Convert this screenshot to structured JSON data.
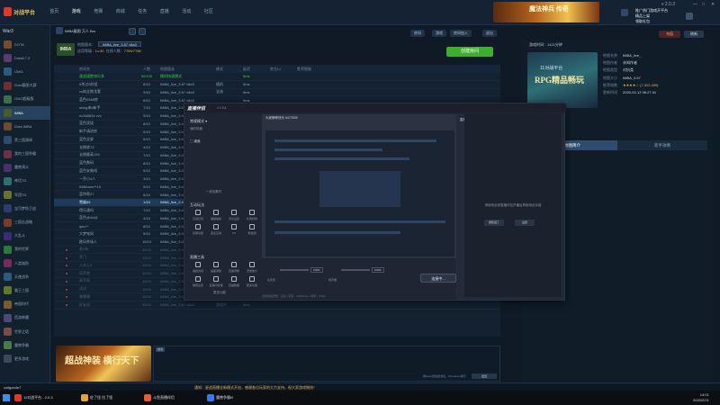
{
  "app": {
    "logo": "对战平台",
    "version": "v 2.0.3"
  },
  "topnav": [
    "首页",
    "游戏",
    "竞赛",
    "商城",
    "任务",
    "直播",
    "活动",
    "社区"
  ],
  "topnav_active": 1,
  "top_banner": {
    "text": "魔法神兵 传奇"
  },
  "top_ad": {
    "line1": "推广热门游戏开平台",
    "line2": "精品上架",
    "line3": "领取礼包"
  },
  "coin_btn": "充值",
  "refresh_btn": "刷新",
  "sidebar": {
    "title": "War3",
    "items": [
      {
        "label": "DOTA",
        "color": "#7a4b2a"
      },
      {
        "label": "Dota6.7.0",
        "color": "#5b3b6e"
      },
      {
        "label": "OMG",
        "color": "#2f5b7a"
      },
      {
        "label": "Dota截图大赛",
        "color": "#6e2f2f"
      },
      {
        "label": "OMG超级版",
        "color": "#3b6e4a"
      },
      {
        "label": "IMBA",
        "color": "#4a5a2f",
        "active": true
      },
      {
        "label": "Dota IMBA",
        "color": "#6e4a2f"
      },
      {
        "label": "黑三国演绎",
        "color": "#2f4a6e"
      },
      {
        "label": "我的三国争霸",
        "color": "#6e2f4a"
      },
      {
        "label": "魔兽演义",
        "color": "#4a2f6e"
      },
      {
        "label": "神话TD",
        "color": "#2f6e6e"
      },
      {
        "label": "军团TD",
        "color": "#6e6e2f"
      },
      {
        "label": "宝可梦防卫战",
        "color": "#2f3b6e"
      },
      {
        "label": "三国志战略",
        "color": "#7a3b2a"
      },
      {
        "label": "大乱斗",
        "color": "#3b2a7a"
      },
      {
        "label": "我的世界",
        "color": "#2a7a3b"
      },
      {
        "label": "人类城防",
        "color": "#7a2a5b"
      },
      {
        "label": "天使战争",
        "color": "#2a5b7a"
      },
      {
        "label": "霸王三国",
        "color": "#5b7a2a"
      },
      {
        "label": "帝国时代",
        "color": "#7a5b2a"
      },
      {
        "label": "西游神魔",
        "color": "#4a4a7a"
      },
      {
        "label": "世界之塔",
        "color": "#7a4a4a"
      },
      {
        "label": "魔兽争霸",
        "color": "#4a7a4a"
      },
      {
        "label": "更多游戏",
        "color": "#3a4a5a"
      }
    ]
  },
  "room": {
    "title": "IMBA截图 万人 Bro",
    "map_label": "地图版本：",
    "map_value": "IMBA_live_3.67 v8a3",
    "level_label": "适用等级：",
    "level_value": "Lv.30",
    "count_label": "在线人数：",
    "count_value": "7755/7758",
    "pills": [
      "房间",
      "游戏",
      "房间加入"
    ],
    "create_btn": "创建房间",
    "exit_btn": "退出"
  },
  "table": {
    "headers": [
      "",
      "房间名",
      "人数",
      "地图版本",
      "模式",
      "延迟",
      "房主Lv",
      "胜率限制"
    ],
    "rows": [
      {
        "c1": "速战速胜快乐多",
        "c2": "50/100",
        "c3": "随机快速模式",
        "c4": "",
        "c5": "5ms",
        "cls": "green"
      },
      {
        "c1": "5杀过5阶组",
        "c2": "8/10",
        "c3": "IMBA_live_3.67 v8a3",
        "c4": "随机",
        "c5": "5ms",
        "cls": ""
      },
      {
        "c1": "vs纯全跑龙套",
        "c2": "9/10",
        "c3": "IMBA_live_3.67 v8a3",
        "c4": "全选",
        "c5": "5ms",
        "cls": ""
      },
      {
        "c1": "蓝色2588房",
        "c2": "6/10",
        "c3": "IMBA_live_3.67 v8a3",
        "c4": "",
        "c5": "5ms",
        "cls": ""
      },
      {
        "c1": "sking来6新手",
        "c2": "7/10",
        "c3": "IMBA_live_3.67 v8a3",
        "c4": "",
        "c5": "5ms",
        "cls": ""
      },
      {
        "c1": "nc368834 vvc",
        "c2": "5/10",
        "c3": "IMBA_live_3.67 v8a3",
        "c4": "",
        "c5": "5ms",
        "cls": ""
      },
      {
        "c1": "蓝色双烧",
        "c2": "8/10",
        "c3": "IMBA_live_3.67 v8a3",
        "c4": "",
        "c5": "5ms",
        "cls": ""
      },
      {
        "c1": "新手请进房",
        "c2": "9/10",
        "c3": "IMBA_live_3.67 v8a3",
        "c4": "",
        "c5": "5ms",
        "cls": ""
      },
      {
        "c1": "蓝色全屏",
        "c2": "6/10",
        "c3": "IMBA_live_3.67 v8a3",
        "c4": "",
        "c5": "5ms",
        "cls": ""
      },
      {
        "c1": "长期收7Z",
        "c2": "4/10",
        "c3": "IMBA_live_3.67 v8a3",
        "c4": "",
        "c5": "5ms",
        "cls": ""
      },
      {
        "c1": "长期最高134",
        "c2": "7/10",
        "c3": "IMBA_live_3.67 v8a3",
        "c4": "",
        "c5": "5ms",
        "cls": ""
      },
      {
        "c1": "蓝色数码",
        "c2": "8/10",
        "c3": "IMBA_live_3.67 v8a3",
        "c4": "",
        "c5": "5ms",
        "cls": ""
      },
      {
        "c1": "蓝色安装线",
        "c2": "5/10",
        "c3": "IMBA_live_3.67 v8a3",
        "c4": "",
        "c5": "5ms",
        "cls": ""
      },
      {
        "c1": "一乔小4人",
        "c2": "3/10",
        "c3": "IMBA_live_3.67 v8a3",
        "c4": "",
        "c5": "5ms",
        "cls": ""
      },
      {
        "c1": "IMBAmm**10",
        "c2": "9/10",
        "c3": "IMBA_live_3.67 v8a3",
        "c4": "",
        "c5": "5ms",
        "cls": ""
      },
      {
        "c1": "蓝特蒂27",
        "c2": "6/10",
        "c3": "IMBA_live_3.67 v8a3",
        "c4": "",
        "c5": "5ms",
        "cls": ""
      },
      {
        "c1": "雪嵩85",
        "c2": "1/10",
        "c3": "IMBA_live_3.67 v8a3",
        "c4": "",
        "c5": "5ms",
        "cls": "sel"
      },
      {
        "c1": "得乐通吗",
        "c2": "7/10",
        "c3": "IMBA_live_3.67 v8a3",
        "c4": "",
        "c5": "5ms",
        "cls": ""
      },
      {
        "c1": "蓝色@4#@",
        "c2": "4/10",
        "c3": "IMBA_live_3.67 v8a3",
        "c4": "",
        "c5": "5ms",
        "cls": ""
      },
      {
        "c1": "ipec**",
        "c2": "8/10",
        "c3": "IMBA_live_3.67 v8a3",
        "c4": "",
        "c5": "5ms",
        "cls": ""
      },
      {
        "c1": "大梦铭如",
        "c2": "5/10",
        "c3": "IMBA_live_3.67 v8a3",
        "c4": "",
        "c5": "5ms",
        "cls": ""
      },
      {
        "c1": "欧风杀场人",
        "c2": "10/10",
        "c3": "IMBA_live_3.67 v8a3",
        "c4": "",
        "c5": "5ms",
        "cls": ""
      },
      {
        "c1": "老4有",
        "c2": "10/10",
        "c3": "IMBA_live_3.67 v8a3",
        "c4": "游戏中",
        "c5": "5ms",
        "cls": "dim"
      },
      {
        "c1": "开门",
        "c2": "10/10",
        "c3": "IMBA_live_3.67 v8a3",
        "c4": "游戏中",
        "c5": "5ms",
        "cls": "dim"
      },
      {
        "c1": "入亦上2",
        "c2": "10/10",
        "c3": "IMBA_live_3.67 v8a3",
        "c4": "游戏中",
        "c5": "5ms",
        "cls": "dim"
      },
      {
        "c1": "同开吧",
        "c2": "10/10",
        "c3": "IMBA_live_3.67 v8a3",
        "c4": "游戏中",
        "c5": "5ms",
        "cls": "dim"
      },
      {
        "c1": "高手局",
        "c2": "10/10",
        "c3": "IMBA_live_3.67 v8a3",
        "c4": "游戏中",
        "c5": "5ms",
        "cls": "dim"
      },
      {
        "c1": "试试",
        "c2": "10/10",
        "c3": "IMBA_live_3.67 v8a3",
        "c4": "游戏中",
        "c5": "5ms",
        "cls": "dim"
      },
      {
        "c1": "嘿嘿嘿",
        "c2": "10/10",
        "c3": "IMBA_live_3.67 v8a3",
        "c4": "游戏中",
        "c5": "5ms",
        "cls": "dim"
      },
      {
        "c1": "好友局",
        "c2": "10/10",
        "c3": "IMBA_live_3.67 v8a3",
        "c4": "游戏中",
        "c5": "5ms",
        "cls": "dim"
      }
    ]
  },
  "bottom_ad": {
    "text": "超战神装 横行天下"
  },
  "chat": {
    "tab": "频道",
    "footer": "按Enter键发送消息，Ctrl+Enter换行",
    "send": "发送"
  },
  "right_panel": {
    "head": "游戏时间：1421分钟",
    "ad": {
      "t1": "11对战平台",
      "t2": "RPG精品畅玩",
      "t3": "1527 4399"
    },
    "info": [
      {
        "k": "地图名称",
        "v": "IMBA_live_"
      },
      {
        "k": "地图作者",
        "v": "未知作者"
      },
      {
        "k": "地图类型",
        "v": "对抗类"
      },
      {
        "k": "地图大小",
        "v": "IMBA_3.67"
      },
      {
        "k": "推荐指数",
        "v": "★★★★☆ (7,312,495)"
      },
      {
        "k": "更新时间",
        "v": "2020-02-12 06:27:41"
      }
    ],
    "tabs": [
      "地图简介",
      "新手攻略"
    ],
    "text": "地图简介："
  },
  "stream_app": {
    "logo": "直播伴侣",
    "version": "v 1.5.4",
    "scene_head": "常规模式",
    "scene_sub": "我的场景",
    "scene_item": "桌面",
    "add_source": "+ 添加素材",
    "group1_title": "互动玩法",
    "group1": [
      "互动红包",
      "福袋抽奖",
      "评论设置",
      "礼物特效",
      "投票功能",
      "连麦互动",
      "PK",
      "粉丝团"
    ],
    "group2_title": "直播工具",
    "group2": [
      "美颜滤镜",
      "画面调整",
      "直播录制",
      "流量统计",
      "弹幕设置",
      "直播间管理",
      "直播数据",
      "更多功能"
    ],
    "more_tools": "更多功能",
    "preview_head": "大家静等快乐 6472525",
    "live_head": "直播间",
    "vol": {
      "mic_label": "麦克风",
      "mic_pct": "100%",
      "spk_label": "扬声器",
      "spk_pct": "100%"
    },
    "start_btn": "连接中...",
    "status": "当前网络质量：良好 | 码率：3200Kbps | 帧率：30fps"
  },
  "popup": {
    "msg": "请使用全部直播伴侣开播后再使用此功能",
    "btn_ok": "我知道了",
    "btn_cancel": "设置"
  },
  "statusbar": {
    "user": "cuilgon4e7",
    "notice": "通知：星战直播全新模式开启，感谢各位玩家的大力支持，祝大家游戏愉快！"
  },
  "taskbar": {
    "items": [
      {
        "label": "11对战平台 - 2.0.3",
        "color": "#d93b2b"
      },
      {
        "label": "佐了怪 拉了怪",
        "color": "#e6a23a"
      },
      {
        "label": "斗鱼直播伴侣",
        "color": "#e65a3a"
      },
      {
        "label": "魔兽争霸III",
        "color": "#3a7ae6"
      }
    ],
    "time": "14:01",
    "date": "2020/2/21"
  }
}
